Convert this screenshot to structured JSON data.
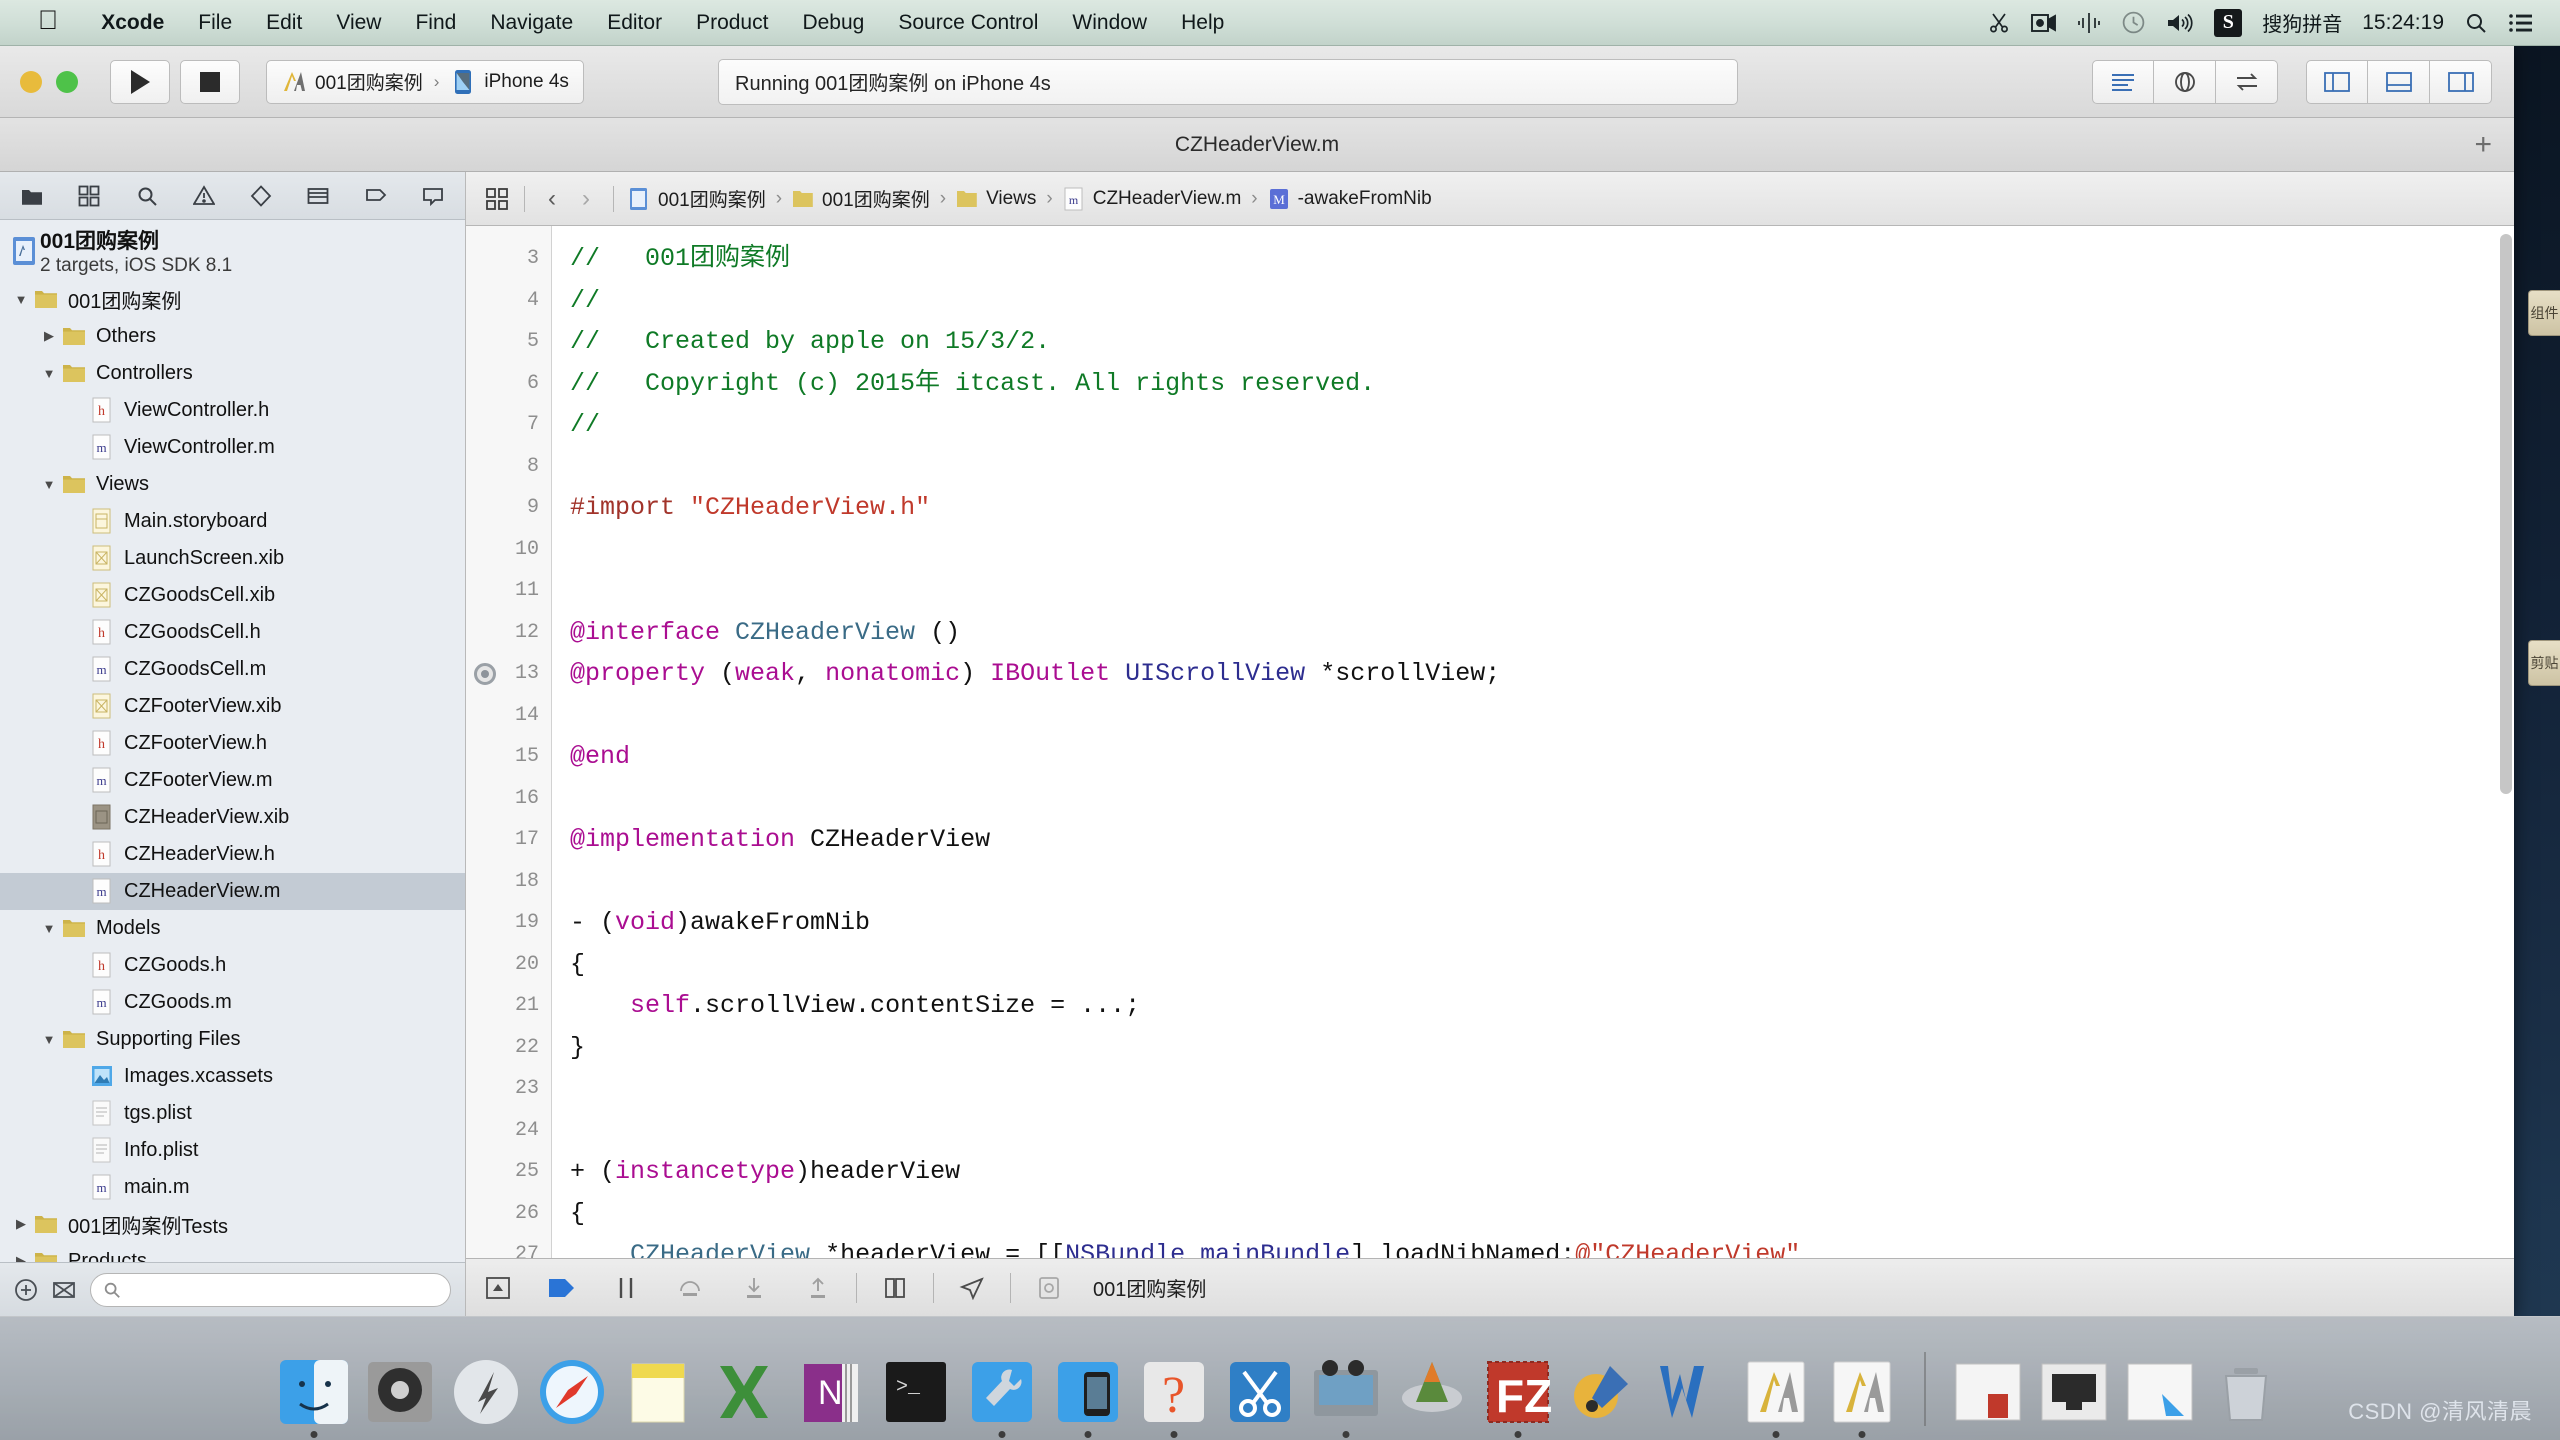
{
  "menubar": {
    "apple_icon": "apple-logo-icon",
    "items": [
      {
        "label": "Xcode",
        "bold": true
      },
      {
        "label": "File",
        "bold": false
      },
      {
        "label": "Edit",
        "bold": false
      },
      {
        "label": "View",
        "bold": false
      },
      {
        "label": "Find",
        "bold": false
      },
      {
        "label": "Navigate",
        "bold": false
      },
      {
        "label": "Editor",
        "bold": false
      },
      {
        "label": "Product",
        "bold": false
      },
      {
        "label": "Debug",
        "bold": false
      },
      {
        "label": "Source Control",
        "bold": false
      },
      {
        "label": "Window",
        "bold": false
      },
      {
        "label": "Help",
        "bold": false
      }
    ],
    "status": {
      "ime_label": "搜狗拼音",
      "sogou_badge": "S",
      "time": "15:24:19",
      "icons": [
        "scissors-icon",
        "screen-record-icon",
        "airplay-icon",
        "clock-icon",
        "volume-icon",
        "search-icon",
        "notification-center-icon"
      ]
    }
  },
  "toolbar": {
    "window_controls": [
      "close",
      "minimize",
      "zoom"
    ],
    "run_button": "run-button",
    "stop_button": "stop-button",
    "scheme": {
      "project": "001团购案例",
      "separator": "›",
      "destination": "iPhone 4s"
    },
    "activity": "Running 001团购案例 on iPhone 4s",
    "right_groups": [
      [
        "standard-editor-icon",
        "assistant-editor-icon",
        "version-editor-icon"
      ],
      [
        "navigator-toggle-icon",
        "debug-area-toggle-icon",
        "utilities-toggle-icon"
      ]
    ]
  },
  "titlebar": {
    "title": "CZHeaderView.m",
    "add_tab": "+"
  },
  "navigator": {
    "tabs": [
      "project-navigator-icon",
      "symbol-navigator-icon",
      "search-navigator-icon",
      "issue-navigator-icon",
      "test-navigator-icon",
      "debug-navigator-icon",
      "breakpoint-navigator-icon",
      "report-navigator-icon"
    ],
    "project": {
      "name": "001团购案例",
      "subtitle": "2 targets, iOS SDK 8.1"
    },
    "tree": [
      {
        "label": "001团购案例",
        "icon": "folder",
        "indent": 0,
        "twisty": "down",
        "selected": false
      },
      {
        "label": "Others",
        "icon": "folder",
        "indent": 1,
        "twisty": "right",
        "selected": false
      },
      {
        "label": "Controllers",
        "icon": "folder",
        "indent": 1,
        "twisty": "down",
        "selected": false
      },
      {
        "label": "ViewController.h",
        "icon": "h",
        "indent": 2,
        "twisty": "none",
        "selected": false
      },
      {
        "label": "ViewController.m",
        "icon": "m",
        "indent": 2,
        "twisty": "none",
        "selected": false
      },
      {
        "label": "Views",
        "icon": "folder",
        "indent": 1,
        "twisty": "down",
        "selected": false
      },
      {
        "label": "Main.storyboard",
        "icon": "storyboard",
        "indent": 2,
        "twisty": "none",
        "selected": false
      },
      {
        "label": "LaunchScreen.xib",
        "icon": "xib",
        "indent": 2,
        "twisty": "none",
        "selected": false
      },
      {
        "label": "CZGoodsCell.xib",
        "icon": "xib",
        "indent": 2,
        "twisty": "none",
        "selected": false
      },
      {
        "label": "CZGoodsCell.h",
        "icon": "h",
        "indent": 2,
        "twisty": "none",
        "selected": false
      },
      {
        "label": "CZGoodsCell.m",
        "icon": "m",
        "indent": 2,
        "twisty": "none",
        "selected": false
      },
      {
        "label": "CZFooterView.xib",
        "icon": "xib",
        "indent": 2,
        "twisty": "none",
        "selected": false
      },
      {
        "label": "CZFooterView.h",
        "icon": "h",
        "indent": 2,
        "twisty": "none",
        "selected": false
      },
      {
        "label": "CZFooterView.m",
        "icon": "m",
        "indent": 2,
        "twisty": "none",
        "selected": false
      },
      {
        "label": "CZHeaderView.xib",
        "icon": "xib-dark",
        "indent": 2,
        "twisty": "none",
        "selected": false
      },
      {
        "label": "CZHeaderView.h",
        "icon": "h",
        "indent": 2,
        "twisty": "none",
        "selected": false
      },
      {
        "label": "CZHeaderView.m",
        "icon": "m",
        "indent": 2,
        "twisty": "none",
        "selected": true
      },
      {
        "label": "Models",
        "icon": "folder",
        "indent": 1,
        "twisty": "down",
        "selected": false
      },
      {
        "label": "CZGoods.h",
        "icon": "h",
        "indent": 2,
        "twisty": "none",
        "selected": false
      },
      {
        "label": "CZGoods.m",
        "icon": "m",
        "indent": 2,
        "twisty": "none",
        "selected": false
      },
      {
        "label": "Supporting Files",
        "icon": "folder",
        "indent": 1,
        "twisty": "down",
        "selected": false
      },
      {
        "label": "Images.xcassets",
        "icon": "xcassets",
        "indent": 2,
        "twisty": "none",
        "selected": false
      },
      {
        "label": "tgs.plist",
        "icon": "plist",
        "indent": 2,
        "twisty": "none",
        "selected": false
      },
      {
        "label": "Info.plist",
        "icon": "plist",
        "indent": 2,
        "twisty": "none",
        "selected": false
      },
      {
        "label": "main.m",
        "icon": "m",
        "indent": 2,
        "twisty": "none",
        "selected": false
      },
      {
        "label": "001团购案例Tests",
        "icon": "folder",
        "indent": 0,
        "twisty": "right",
        "selected": false
      },
      {
        "label": "Products",
        "icon": "folder",
        "indent": 0,
        "twisty": "right",
        "selected": false
      }
    ],
    "filter": {
      "add_icon": "add-file-icon",
      "related_icon": "show-related-icon",
      "placeholder": ""
    }
  },
  "jumpbar": {
    "related_items_icon": "related-items-icon",
    "back_arrow": "‹",
    "forward_arrow": "›",
    "crumbs": [
      {
        "label": "001团购案例",
        "icon": "project-icon"
      },
      {
        "label": "001团购案例",
        "icon": "folder-icon"
      },
      {
        "label": "Views",
        "icon": "folder-icon"
      },
      {
        "label": "CZHeaderView.m",
        "icon": "m-file-icon"
      },
      {
        "label": "-awakeFromNib",
        "icon": "method-icon"
      }
    ]
  },
  "code": {
    "first_line_number": 3,
    "breakpoint_line": 13,
    "lines": [
      {
        "n": 3,
        "tokens": [
          {
            "t": "//   001团购案例",
            "c": "cm"
          }
        ]
      },
      {
        "n": 4,
        "tokens": [
          {
            "t": "//",
            "c": "cm"
          }
        ]
      },
      {
        "n": 5,
        "tokens": [
          {
            "t": "//   Created by apple on 15/3/2.",
            "c": "cm"
          }
        ]
      },
      {
        "n": 6,
        "tokens": [
          {
            "t": "//   Copyright (c) 2015年 itcast. All rights reserved.",
            "c": "cm"
          }
        ]
      },
      {
        "n": 7,
        "tokens": [
          {
            "t": "//",
            "c": "cm"
          }
        ]
      },
      {
        "n": 8,
        "tokens": []
      },
      {
        "n": 9,
        "tokens": [
          {
            "t": "#import ",
            "c": "pp"
          },
          {
            "t": "\"CZHeaderView.h\"",
            "c": "str"
          }
        ]
      },
      {
        "n": 10,
        "tokens": []
      },
      {
        "n": 11,
        "tokens": []
      },
      {
        "n": 12,
        "tokens": [
          {
            "t": "@interface ",
            "c": "kw"
          },
          {
            "t": "CZHeaderView ",
            "c": "ty"
          },
          {
            "t": "()",
            "c": "pl"
          }
        ]
      },
      {
        "n": 13,
        "tokens": [
          {
            "t": "@property ",
            "c": "kw"
          },
          {
            "t": "(",
            "c": "pl"
          },
          {
            "t": "weak",
            "c": "kw"
          },
          {
            "t": ", ",
            "c": "pl"
          },
          {
            "t": "nonatomic",
            "c": "kw"
          },
          {
            "t": ") ",
            "c": "pl"
          },
          {
            "t": "IBOutlet ",
            "c": "kw"
          },
          {
            "t": "UIScrollView ",
            "c": "id"
          },
          {
            "t": "*scrollView;",
            "c": "pl"
          }
        ]
      },
      {
        "n": 14,
        "tokens": []
      },
      {
        "n": 15,
        "tokens": [
          {
            "t": "@end",
            "c": "kw"
          }
        ]
      },
      {
        "n": 16,
        "tokens": []
      },
      {
        "n": 17,
        "tokens": [
          {
            "t": "@implementation ",
            "c": "kw"
          },
          {
            "t": "CZHeaderView",
            "c": "pl"
          }
        ]
      },
      {
        "n": 18,
        "tokens": []
      },
      {
        "n": 19,
        "tokens": [
          {
            "t": "- (",
            "c": "pl"
          },
          {
            "t": "void",
            "c": "kw"
          },
          {
            "t": ")awakeFromNib",
            "c": "pl"
          }
        ]
      },
      {
        "n": 20,
        "tokens": [
          {
            "t": "{",
            "c": "pl"
          }
        ]
      },
      {
        "n": 21,
        "tokens": [
          {
            "t": "    ",
            "c": "pl"
          },
          {
            "t": "self",
            "c": "kw"
          },
          {
            "t": ".scrollView.contentSize = ...;",
            "c": "pl"
          }
        ]
      },
      {
        "n": 22,
        "tokens": [
          {
            "t": "}",
            "c": "pl"
          }
        ]
      },
      {
        "n": 23,
        "tokens": []
      },
      {
        "n": 24,
        "tokens": []
      },
      {
        "n": 25,
        "tokens": [
          {
            "t": "+ (",
            "c": "pl"
          },
          {
            "t": "instancetype",
            "c": "kw"
          },
          {
            "t": ")headerView",
            "c": "pl"
          }
        ]
      },
      {
        "n": 26,
        "tokens": [
          {
            "t": "{",
            "c": "pl"
          }
        ]
      },
      {
        "n": 27,
        "tokens": [
          {
            "t": "    ",
            "c": "pl"
          },
          {
            "t": "CZHeaderView ",
            "c": "ty"
          },
          {
            "t": "*headerView = [[",
            "c": "pl"
          },
          {
            "t": "NSBundle ",
            "c": "id"
          },
          {
            "t": "mainBundle",
            "c": "id"
          },
          {
            "t": "] loadNibNamed:",
            "c": "pl"
          },
          {
            "t": "@\"CZHeaderView\"",
            "c": "str"
          }
        ]
      }
    ]
  },
  "debugbar": {
    "icons": [
      "hide-debug-area-icon",
      "continue-icon",
      "pause-icon",
      "step-over-icon",
      "step-into-icon",
      "step-out-icon",
      "view-debug-icon",
      "location-simulate-icon",
      "process-icon"
    ],
    "scheme_label": "001团购案例"
  },
  "edge_tabs": [
    {
      "label": "组件"
    },
    {
      "label": "剪贴"
    }
  ],
  "dock": {
    "items": [
      {
        "name": "finder-icon",
        "running": true
      },
      {
        "name": "system-preferences-icon",
        "running": false
      },
      {
        "name": "launchpad-icon",
        "running": false
      },
      {
        "name": "safari-icon",
        "running": false
      },
      {
        "name": "stickies-icon",
        "running": false
      },
      {
        "name": "excel-icon",
        "running": false
      },
      {
        "name": "onenote-icon",
        "running": false
      },
      {
        "name": "terminal-icon",
        "running": false
      },
      {
        "name": "utilities-icon",
        "running": true
      },
      {
        "name": "devices-icon",
        "running": true
      },
      {
        "name": "help-icon",
        "running": true
      },
      {
        "name": "snipaste-icon",
        "running": false
      },
      {
        "name": "quicktime-icon",
        "running": true
      },
      {
        "name": "vlc-icon",
        "running": false
      },
      {
        "name": "filezilla-icon",
        "running": true
      },
      {
        "name": "paint-icon",
        "running": false
      },
      {
        "name": "word-icon",
        "running": false
      },
      {
        "name": "xcode-a-icon",
        "running": true
      },
      {
        "name": "xcode-b-icon",
        "running": true
      }
    ],
    "minimized": [
      {
        "name": "window-min-1-icon"
      },
      {
        "name": "window-min-2-icon"
      },
      {
        "name": "window-min-3-icon"
      },
      {
        "name": "trash-icon"
      }
    ]
  },
  "watermark": "CSDN @清风清晨"
}
